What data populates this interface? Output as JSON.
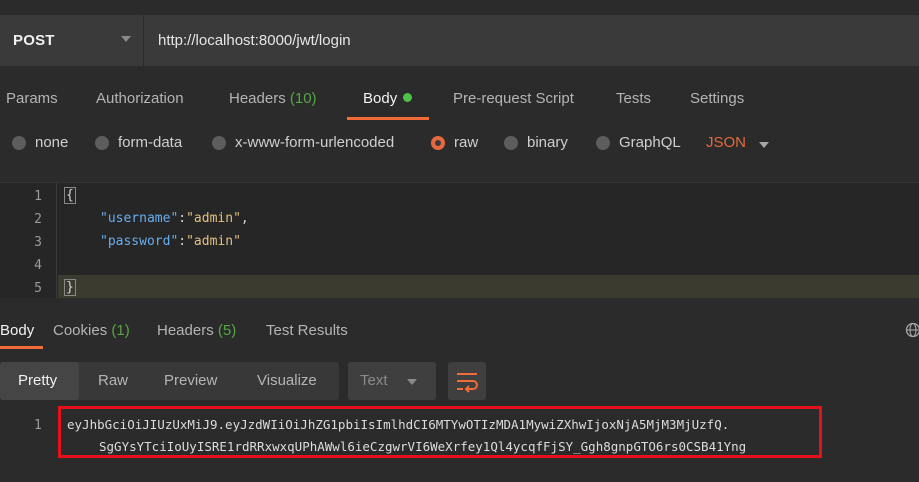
{
  "request": {
    "method": "POST",
    "url": "http://localhost:8000/jwt/login"
  },
  "request_tabs": {
    "params": "Params",
    "authorization": "Authorization",
    "headers": "Headers",
    "headers_count": "(10)",
    "body": "Body",
    "prerequest": "Pre-request Script",
    "tests": "Tests",
    "settings": "Settings",
    "active": "Body"
  },
  "body_types": {
    "none": "none",
    "form_data": "form-data",
    "urlencoded": "x-www-form-urlencoded",
    "raw": "raw",
    "binary": "binary",
    "graphql": "GraphQL",
    "selected": "raw",
    "format": "JSON"
  },
  "editor": {
    "line_numbers": [
      "1",
      "2",
      "3",
      "4",
      "5"
    ],
    "open_brace": "{",
    "close_brace": "}",
    "username_key": "\"username\"",
    "username_value": "\"admin\"",
    "password_key": "\"password\"",
    "password_value": "\"admin\""
  },
  "response_tabs": {
    "body": "Body",
    "cookies": "Cookies",
    "cookies_count": "(1)",
    "headers": "Headers",
    "headers_count": "(5)",
    "test_results": "Test Results",
    "active": "Body"
  },
  "response_toolbar": {
    "pretty": "Pretty",
    "raw": "Raw",
    "preview": "Preview",
    "visualize": "Visualize",
    "format": "Text",
    "active": "Pretty"
  },
  "response_body": {
    "line_number": "1",
    "token_line1": "eyJhbGciOiJIUzUxMiJ9.eyJzdWIiOiJhZG1pbiIsImlhdCI6MTYwOTIzMDA1MywiZXhwIjoxNjA5MjM3MjUzfQ.",
    "token_line2": "SgGYsYTciIoUyISRE1rdRRxwxqUPhAWwl6ieCzgwrVI6WeXrfey1Ql4ycqfFjSY_Ggh8gnpGTO6rs0CSB41Yng"
  },
  "colors": {
    "accent": "#f26b3a",
    "green": "#4ec146",
    "highlight_box": "#e8111b"
  }
}
